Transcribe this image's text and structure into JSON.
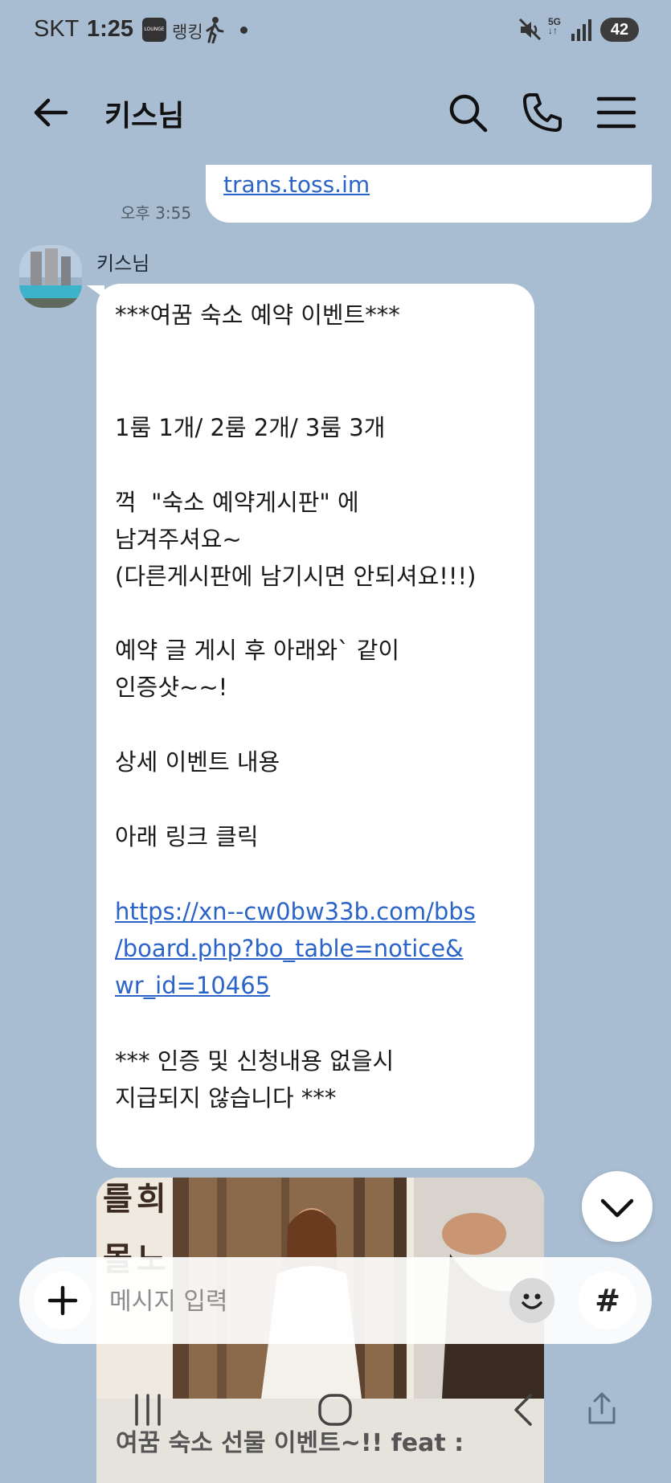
{
  "status_bar": {
    "carrier": "SKT",
    "time": "1:25",
    "app_badge": "LOUNGE",
    "ranking_label": "랭킹",
    "network": "5G",
    "battery": "42"
  },
  "header": {
    "title": "키스님",
    "icons": [
      "back-arrow-icon",
      "search-icon",
      "phone-icon",
      "menu-icon"
    ]
  },
  "previous_message": {
    "link_text": "trans.toss.im",
    "time": "오후 3:55"
  },
  "message": {
    "sender": "키스님",
    "lines": [
      "***여꿈 숙소 예약 이벤트***",
      "1룸 1개/ 2룸 2개/ 3룸 3개",
      "꺽  \"숙소 예약게시판\" 에",
      "남겨주셔요~",
      "(다른게시판에 남기시면 안되셔요!!!)",
      "예약 글 게시 후 아래와` 같이",
      "인증샷~~!",
      "상세 이벤트 내용",
      "아래 링크 클릭",
      "*** 인증 및 신청내용 없을시",
      "지급되지 않습니다 ***"
    ],
    "link_lines": [
      "https://xn--cw0bw33b.com/bbs",
      "/board.php?bo_table=notice&",
      "wr_id=10465"
    ]
  },
  "image_card": {
    "side_text": "를 희 몰 노",
    "caption": "여꿈 숙소 선물 이벤트~!! feat :"
  },
  "input": {
    "placeholder": "메시지 입력",
    "hash_label": "#"
  },
  "colors": {
    "background": "#a9bdd2",
    "bubble": "#ffffff",
    "link": "#2a64c8"
  }
}
